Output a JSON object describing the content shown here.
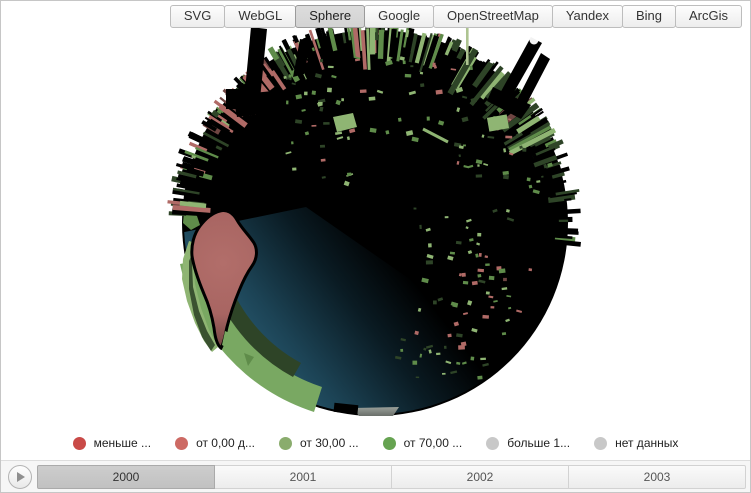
{
  "tabs": {
    "items": [
      "SVG",
      "WebGL",
      "Sphere",
      "Google",
      "OpenStreetMap",
      "Yandex",
      "Bing",
      "ArcGis"
    ],
    "active": "Sphere",
    "active_index": 2
  },
  "legend": {
    "items": [
      {
        "label": "меньше ...",
        "color": "#c94a47"
      },
      {
        "label": "от 0,00 д...",
        "color": "#cd6a64"
      },
      {
        "label": "от 30,00 ...",
        "color": "#8aac6d"
      },
      {
        "label": "от 70,00 ...",
        "color": "#66a351"
      },
      {
        "label": "больше 1...",
        "color": "#c8c8c8"
      },
      {
        "label": "нет данных",
        "color": "#c8c8c8"
      }
    ]
  },
  "timeline": {
    "years": [
      "2000",
      "2001",
      "2002",
      "2003"
    ],
    "selected": "2000",
    "selected_index": 0
  },
  "globe": {
    "seed": 11,
    "palette": {
      "black": "#000000",
      "dark_green": "#2e4427",
      "green": "#5f8c4a",
      "light_green": "#8fb573",
      "pale_green": "#aec491",
      "salmon": "#b06a66",
      "dark_red": "#6f4542",
      "ocean_teal": "#2f6780",
      "ocean_mid": "#1c4355",
      "ocean_deep": "#0a1b23",
      "south_america": "#a86562",
      "glow_gray": "#6a6f6a"
    }
  }
}
